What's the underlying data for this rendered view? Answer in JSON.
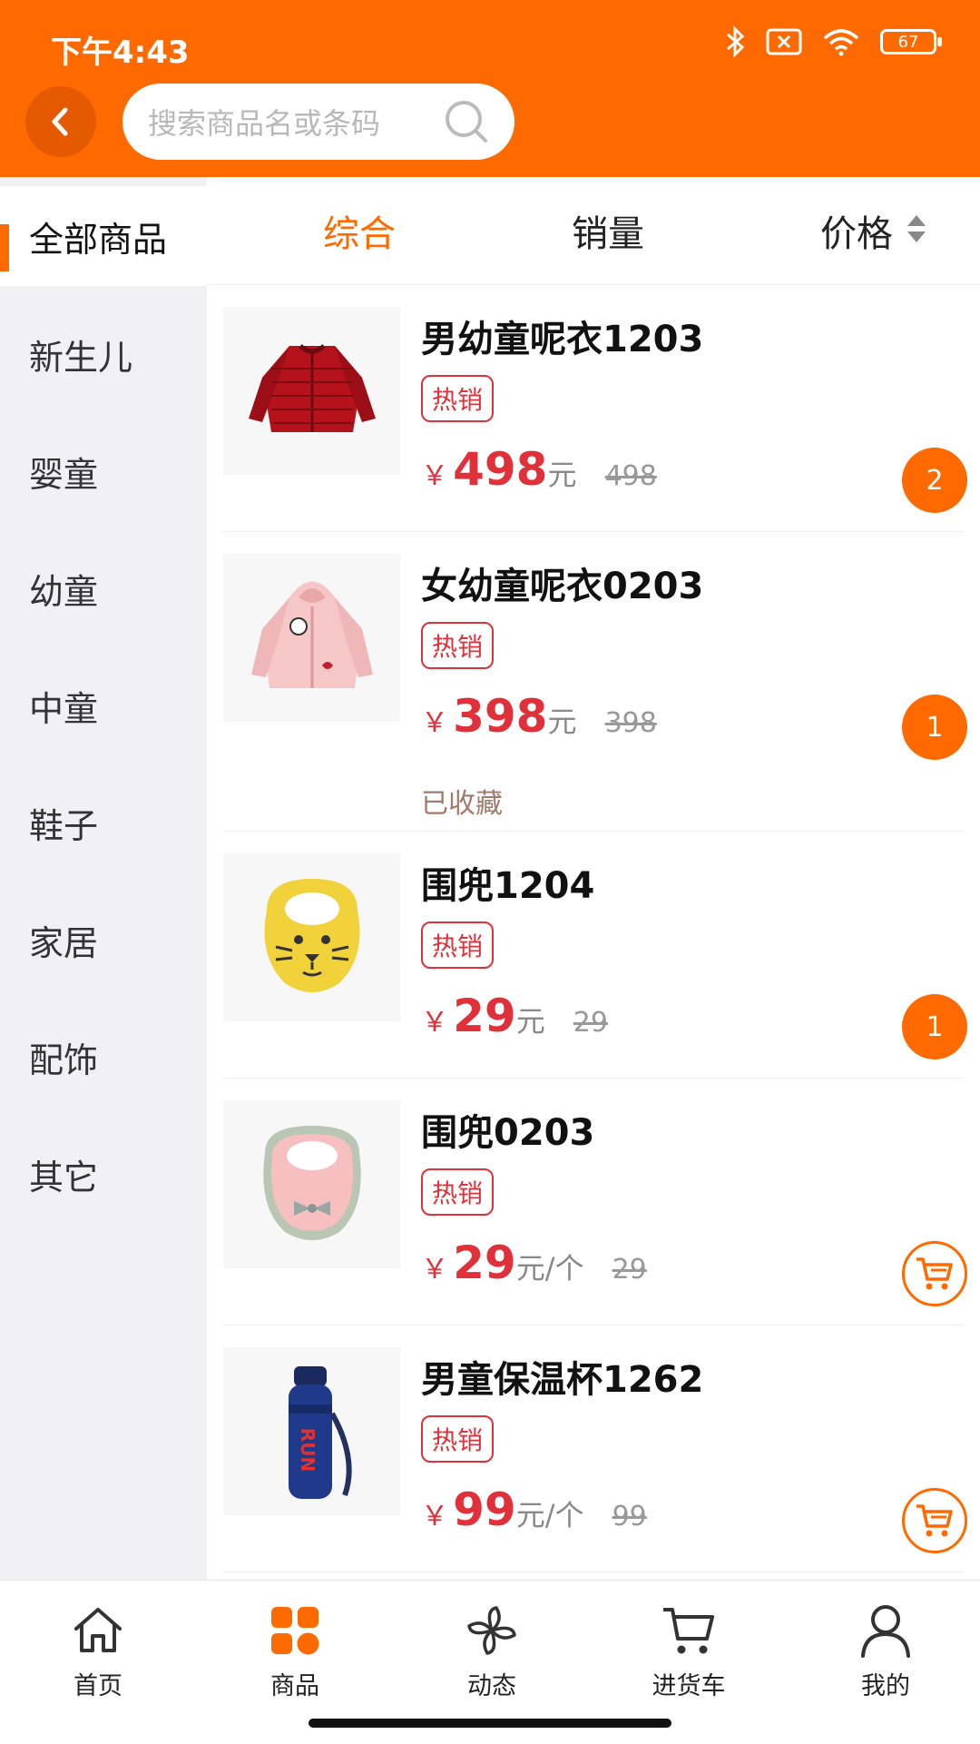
{
  "status_bar": {
    "time": "下午4:43",
    "battery": "67"
  },
  "header": {
    "search_placeholder": "搜索商品名或条码"
  },
  "sidebar": {
    "items": [
      {
        "label": "全部商品",
        "active": true
      },
      {
        "label": "新生儿"
      },
      {
        "label": "婴童"
      },
      {
        "label": "幼童"
      },
      {
        "label": "中童"
      },
      {
        "label": "鞋子"
      },
      {
        "label": "家居"
      },
      {
        "label": "配饰"
      },
      {
        "label": "其它"
      }
    ]
  },
  "sort_tabs": [
    {
      "label": "综合",
      "active": true
    },
    {
      "label": "销量"
    },
    {
      "label": "价格"
    }
  ],
  "products": [
    {
      "name": "男幼童呢衣1203",
      "tag": "热销",
      "currency": "￥",
      "price": "498",
      "unit": "元",
      "original": "498",
      "qty": "2",
      "fav": ""
    },
    {
      "name": "女幼童呢衣0203",
      "tag": "热销",
      "currency": "￥",
      "price": "398",
      "unit": "元",
      "original": "398",
      "qty": "1",
      "fav": "已收藏"
    },
    {
      "name": "围兜1204",
      "tag": "热销",
      "currency": "￥",
      "price": "29",
      "unit": "元",
      "original": "29",
      "qty": "1",
      "fav": ""
    },
    {
      "name": "围兜0203",
      "tag": "热销",
      "currency": "￥",
      "price": "29",
      "unit": "元/个",
      "original": "29",
      "qty": "",
      "fav": ""
    },
    {
      "name": "男童保温杯1262",
      "tag": "热销",
      "currency": "￥",
      "price": "99",
      "unit": "元/个",
      "original": "99",
      "qty": "",
      "fav": ""
    }
  ],
  "tabbar": [
    {
      "label": "首页",
      "icon": "home-icon"
    },
    {
      "label": "商品",
      "icon": "grid-icon",
      "active": true
    },
    {
      "label": "动态",
      "icon": "pinwheel-icon"
    },
    {
      "label": "进货车",
      "icon": "cart-icon"
    },
    {
      "label": "我的",
      "icon": "user-icon"
    }
  ],
  "colors": {
    "accent": "#ff6a00",
    "price": "#e0303a"
  }
}
